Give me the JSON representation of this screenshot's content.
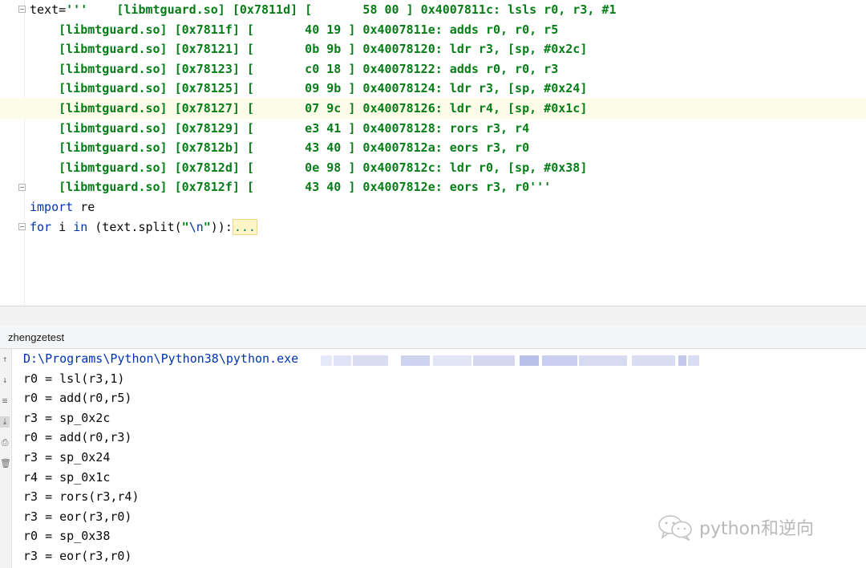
{
  "editor": {
    "lines": [
      {
        "segments": [
          {
            "t": "text=",
            "c": "plain"
          },
          {
            "t": "'''    [libmtguard.so] [0x7811d] [       58 00 ] 0x4007811c: lsls r0, r3, #1",
            "c": "str"
          }
        ]
      },
      {
        "segments": [
          {
            "t": "    [libmtguard.so] [0x7811f] [       40 19 ] 0x4007811e: adds r0, r0, r5",
            "c": "str"
          }
        ]
      },
      {
        "segments": [
          {
            "t": "    [libmtguard.so] [0x78121] [       0b 9b ] 0x40078120: ldr r3, [sp, #0x2c]",
            "c": "str"
          }
        ]
      },
      {
        "segments": [
          {
            "t": "    [libmtguard.so] [0x78123] [       c0 18 ] 0x40078122: adds r0, r0, r3",
            "c": "str"
          }
        ]
      },
      {
        "segments": [
          {
            "t": "    [libmtguard.so] [0x78125] [       09 9b ] 0x40078124: ldr r3, [sp, #0x24]",
            "c": "str"
          }
        ]
      },
      {
        "segments": [
          {
            "t": "    [libmtguard.so] [0x78127] [       07 9c ] 0x40078126: ldr r4, [sp, #0x1c]",
            "c": "str"
          }
        ]
      },
      {
        "segments": [
          {
            "t": "    [libmtguard.so] [0x78129] [       e3 41 ] 0x40078128: rors r3, r4",
            "c": "str"
          }
        ]
      },
      {
        "segments": [
          {
            "t": "    [libmtguard.so] [0x7812b] [       43 40 ] 0x4007812a: eors r3, r0",
            "c": "str"
          }
        ]
      },
      {
        "segments": [
          {
            "t": "    [libmtguard.so] [0x7812d] [       0e 98 ] 0x4007812c: ldr r0, [sp, #0x38]",
            "c": "str"
          }
        ]
      },
      {
        "segments": [
          {
            "t": "    [libmtguard.so] [0x7812f] [       43 40 ] 0x4007812e: eors r3, r0'''",
            "c": "str"
          }
        ]
      },
      {
        "segments": [
          {
            "t": "import",
            "c": "kw"
          },
          {
            "t": " re",
            "c": "plain"
          }
        ]
      },
      {
        "segments": [
          {
            "t": "for",
            "c": "kw"
          },
          {
            "t": " i ",
            "c": "plain"
          },
          {
            "t": "in",
            "c": "kw"
          },
          {
            "t": " (text.split(",
            "c": "plain"
          },
          {
            "t": "\"",
            "c": "str"
          },
          {
            "t": "\\n",
            "c": "esc"
          },
          {
            "t": "\"",
            "c": "str"
          },
          {
            "t": ")):",
            "c": "plain"
          },
          {
            "t": "...",
            "c": "fold-marker"
          }
        ]
      }
    ],
    "highlighted_line": 5
  },
  "run": {
    "tab_label": "zhengzetest",
    "command": "D:\\Programs\\Python\\Python38\\python.exe",
    "output": [
      "r0 = lsl(r3,1)",
      "r0 = add(r0,r5)",
      "r3 = sp_0x2c",
      "r0 = add(r0,r3)",
      "r3 = sp_0x24",
      "r4 = sp_0x1c",
      "r3 = rors(r3,r4)",
      "r3 = eor(r3,r0)",
      "r0 = sp_0x38",
      "r3 = eor(r3,r0)"
    ]
  },
  "watermark": {
    "text": "python和逆向",
    "icon": "wechat-bubble-icon"
  },
  "colors": {
    "string": "#067d17",
    "keyword": "#0033b3",
    "highlight_line": "#fdfce9",
    "path": "#0033b3"
  }
}
